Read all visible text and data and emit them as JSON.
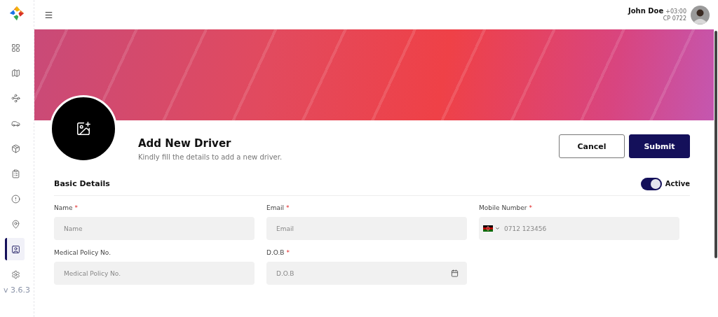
{
  "sidebar": {
    "items": [
      {
        "selected": false
      },
      {
        "selected": false
      },
      {
        "selected": false
      },
      {
        "selected": false
      },
      {
        "selected": false
      },
      {
        "selected": false
      },
      {
        "selected": false
      },
      {
        "selected": false
      },
      {
        "selected": true
      },
      {
        "selected": false
      }
    ],
    "version": "v 3.6.3"
  },
  "header": {
    "user_name": "John Doe",
    "timezone": "+03:00",
    "user_code": "CP 0722"
  },
  "page": {
    "title": "Add New Driver",
    "subtitle": "Kindly fill the details to add a new driver.",
    "buttons": [
      {
        "label": "Cancel",
        "kind": "secondary"
      },
      {
        "label": "Submit",
        "kind": "primary"
      }
    ]
  },
  "section": {
    "title": "Basic Details",
    "toggle": {
      "label": "Active",
      "on": true
    }
  },
  "fields": [
    {
      "label": "Name",
      "required_mark": "*",
      "placeholder": "Name",
      "kind": "text"
    },
    {
      "label": "Email",
      "required_mark": "*",
      "placeholder": "Email",
      "kind": "text"
    },
    {
      "label": "Mobile Number",
      "required_mark": "*",
      "placeholder": "0712 123456",
      "kind": "phone"
    },
    {
      "label": "Medical Policy No.",
      "placeholder": "Medical Policy No.",
      "kind": "text"
    },
    {
      "label": "D.O.B",
      "required_mark": "*",
      "placeholder": "D.O.B",
      "kind": "date"
    }
  ]
}
